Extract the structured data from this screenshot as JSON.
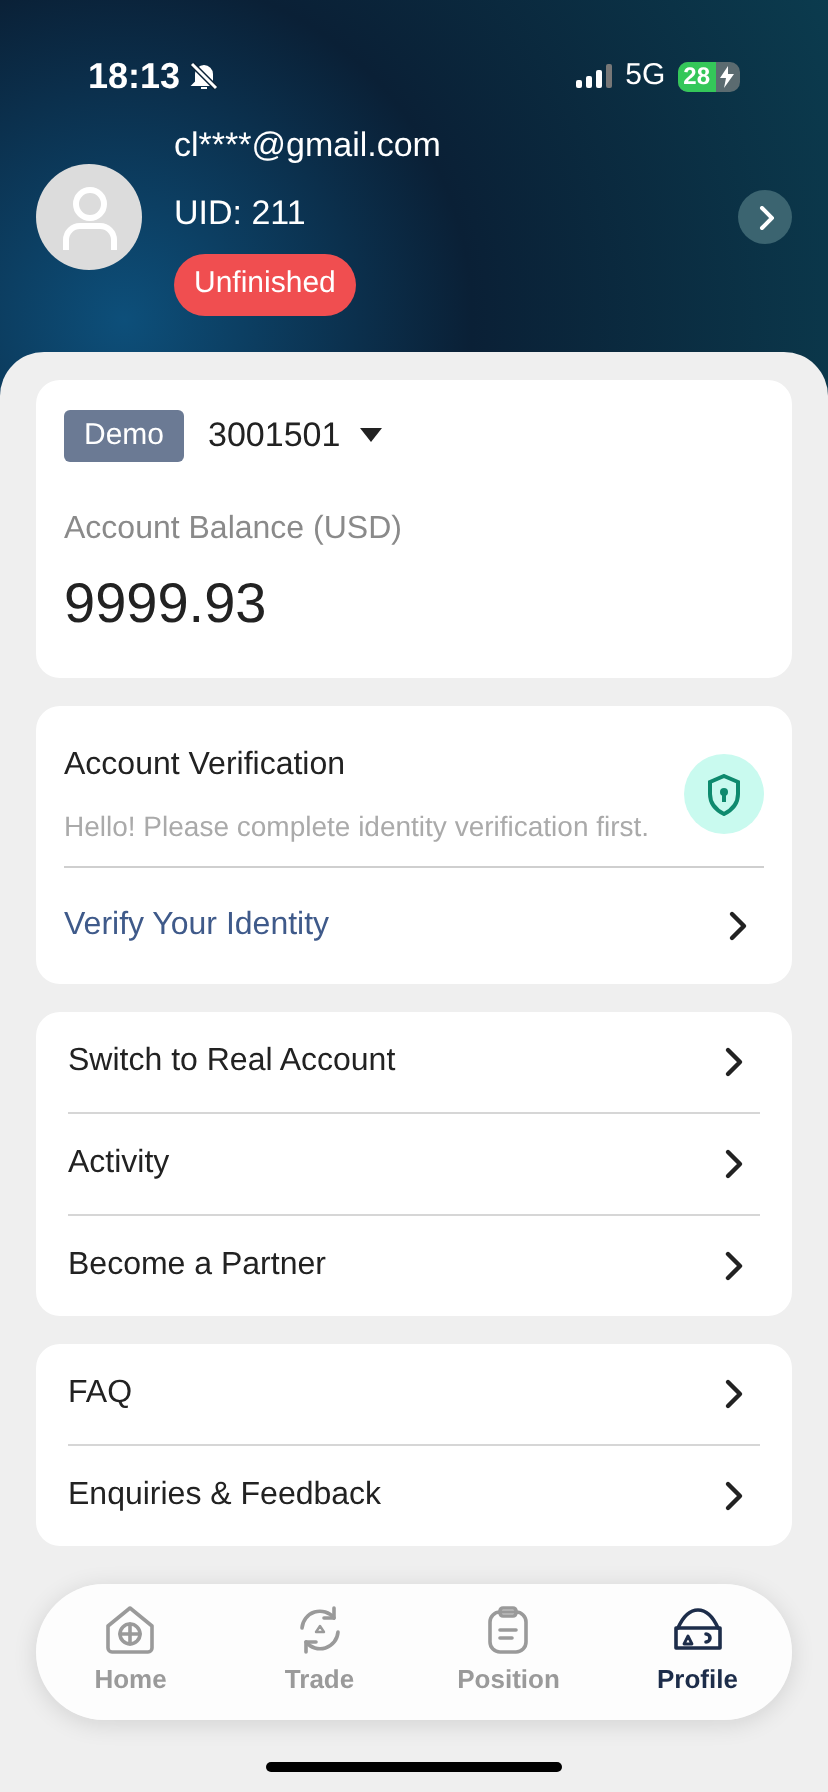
{
  "status_bar": {
    "time": "18:13",
    "network": "5G",
    "battery": "28"
  },
  "profile": {
    "email": "cl****@gmail.com",
    "uid": "UID: 211",
    "badge": "Unfinished"
  },
  "account": {
    "tag": "Demo",
    "number": "3001501",
    "balance_label": "Account Balance (USD)",
    "balance": "9999.93"
  },
  "verification": {
    "title": "Account Verification",
    "message": "Hello! Please complete identity verification first.",
    "link": "Verify Your Identity"
  },
  "menu_groups": [
    {
      "items": [
        "Switch to Real Account",
        "Activity",
        "Become a Partner"
      ]
    },
    {
      "items": [
        "FAQ",
        "Enquiries & Feedback"
      ]
    }
  ],
  "tab_bar": [
    {
      "label": "Home",
      "kind": "home",
      "selected": false
    },
    {
      "label": "Trade",
      "kind": "trade",
      "selected": false
    },
    {
      "label": "Position",
      "kind": "position",
      "selected": false
    },
    {
      "label": "Profile",
      "kind": "profile",
      "selected": true
    }
  ]
}
